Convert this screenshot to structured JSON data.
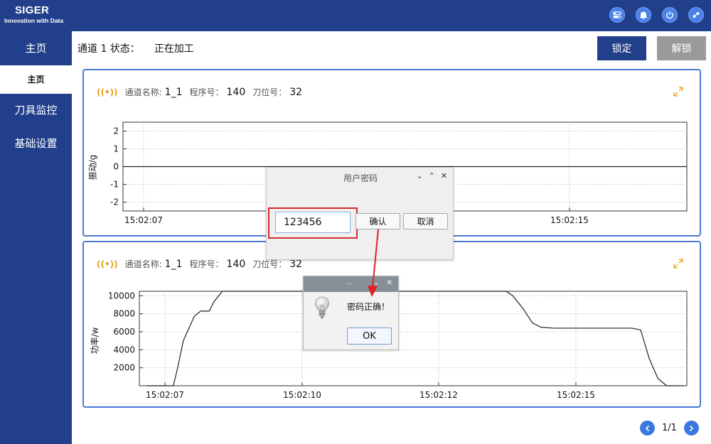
{
  "header": {
    "brand_name": "SIGER",
    "brand_tagline": "Innovation with Data",
    "icons": [
      "toggle-icon",
      "bell-icon",
      "power-icon",
      "connection-icon"
    ]
  },
  "sidebar": {
    "items": [
      {
        "label": "主页"
      },
      {
        "label": "主页"
      },
      {
        "label": "刀具监控"
      },
      {
        "label": "基础设置"
      }
    ]
  },
  "status": {
    "label": "通道 1 状态：",
    "value": "正在加工"
  },
  "buttons": {
    "lock": "锁定",
    "unlock": "解锁"
  },
  "panels": [
    {
      "channel_label": "通道名称:",
      "channel_value": "1_1",
      "program_label": "程序号：",
      "program_value": "140",
      "tool_label": "刀位号：",
      "tool_value": "32",
      "ylabel": "振动/g",
      "yticks": [
        "2",
        "1",
        "0",
        "-1",
        "-2"
      ],
      "xticks": [
        "15:02:07",
        "15:02:15"
      ]
    },
    {
      "channel_label": "通道名称:",
      "channel_value": "1_1",
      "program_label": "程序号：",
      "program_value": "140",
      "tool_label": "刀位号：",
      "tool_value": "32",
      "ylabel": "功率/w",
      "yticks": [
        "10000",
        "8000",
        "6000",
        "4000",
        "2000"
      ],
      "xticks": [
        "15:02:07",
        "15:02:10",
        "15:02:12",
        "15:02:15"
      ]
    }
  ],
  "dialog_password": {
    "title": "用户密码",
    "input_value": "123456",
    "confirm": "确认",
    "cancel": "取消"
  },
  "dialog_result": {
    "title": "...",
    "message": "密码正确！",
    "ok": "OK"
  },
  "pager": {
    "text": "1/1"
  },
  "chart_data": [
    {
      "type": "line",
      "ylabel": "振动/g",
      "ylim": [
        -2.5,
        2.5
      ],
      "yticks": [
        2,
        1,
        0,
        -1,
        -2
      ],
      "xticks": [
        "15:02:07",
        "15:02:15"
      ],
      "grid": true,
      "series": [
        {
          "x": [
            "15:02:07",
            "15:02:08",
            "15:02:09",
            "15:02:10",
            "15:02:11",
            "15:02:12",
            "15:02:13",
            "15:02:14",
            "15:02:15",
            "15:02:16"
          ],
          "values": [
            0,
            0,
            0,
            0,
            0,
            0,
            0,
            0,
            0,
            0
          ]
        }
      ]
    },
    {
      "type": "line",
      "ylabel": "功率/w",
      "ylim": [
        0,
        10500
      ],
      "yticks": [
        10000,
        8000,
        6000,
        4000,
        2000
      ],
      "xticks": [
        "15:02:07",
        "15:02:10",
        "15:02:12",
        "15:02:15"
      ],
      "grid": true,
      "series": [
        {
          "t": [
            0.0,
            0.5,
            0.62,
            0.72,
            0.85,
            1.1,
            1.25,
            1.45,
            1.55,
            1.75,
            2.3,
            6.0,
            8.3,
            8.45,
            8.7,
            8.9,
            9.1,
            9.4,
            11.2,
            11.4,
            11.6,
            11.8,
            12.0,
            12.4
          ],
          "values": [
            0,
            0,
            0,
            2000,
            5000,
            7700,
            8300,
            8300,
            9300,
            10500,
            10500,
            10500,
            10500,
            10000,
            8500,
            7000,
            6500,
            6400,
            6400,
            6200,
            3000,
            800,
            0,
            0
          ]
        }
      ]
    }
  ]
}
